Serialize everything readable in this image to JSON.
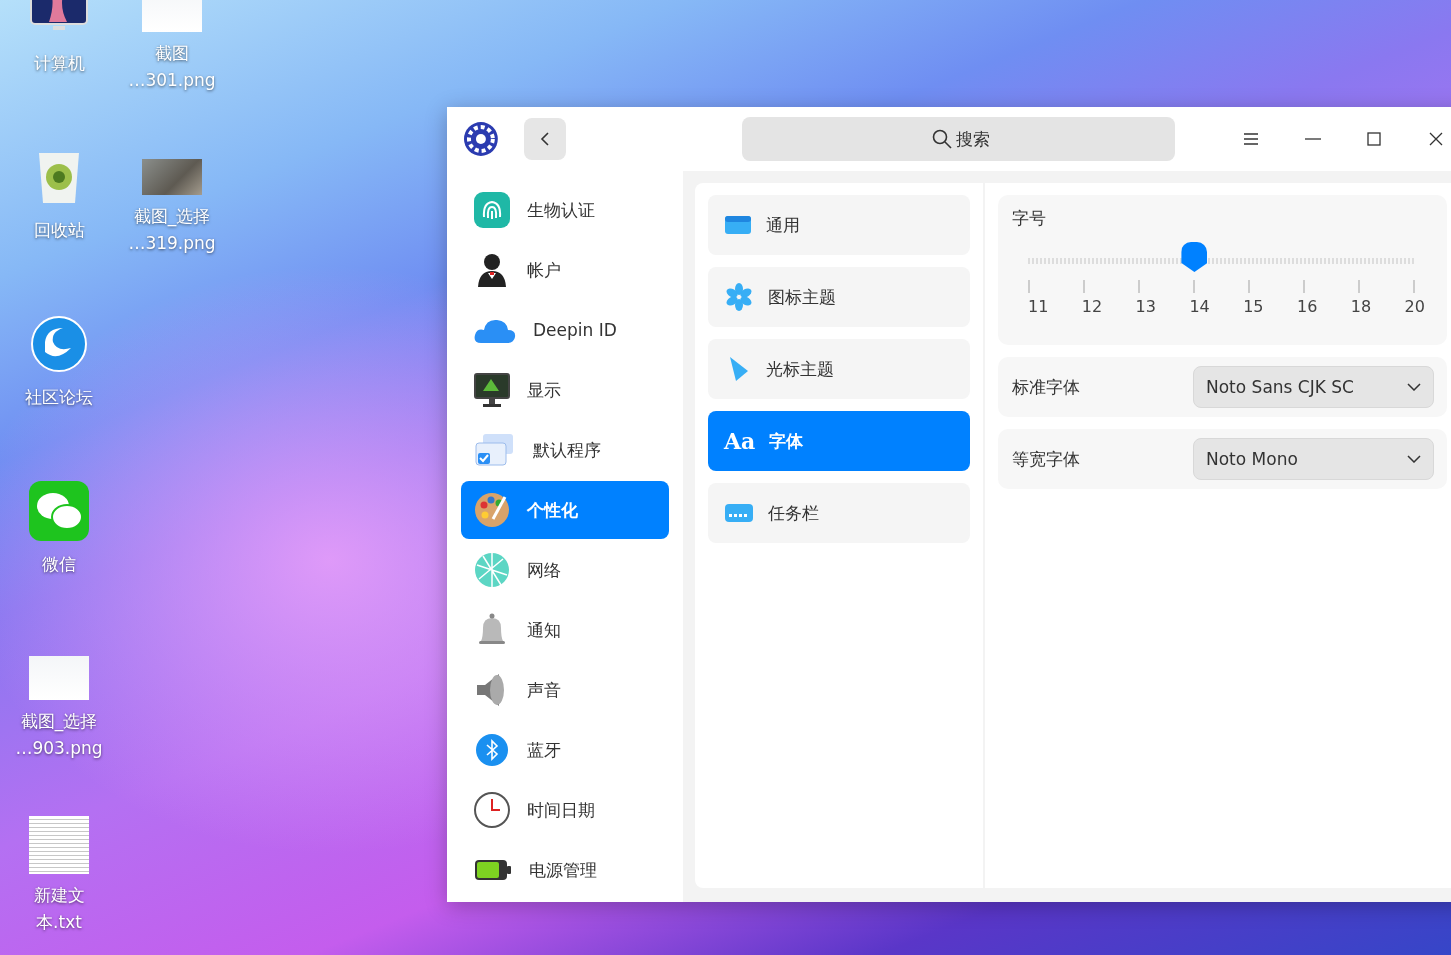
{
  "desktop_icons": [
    {
      "label_lines": [
        "计算机"
      ],
      "kind": "computer"
    },
    {
      "label_lines": [
        "回收站"
      ],
      "kind": "trash"
    },
    {
      "label_lines": [
        "社区论坛"
      ],
      "kind": "forum"
    },
    {
      "label_lines": [
        "微信"
      ],
      "kind": "chat"
    },
    {
      "label_lines": [
        "截图_选择",
        "…903.png"
      ],
      "kind": "image"
    },
    {
      "label_lines": [
        "新建文",
        "本.txt"
      ],
      "kind": "text"
    },
    {
      "label_lines": [
        "截图",
        "…301.png"
      ],
      "kind": "image"
    },
    {
      "label_lines": [
        "截图_选择",
        "…319.png"
      ],
      "kind": "photo"
    }
  ],
  "window": {
    "search": {
      "placeholder": "搜索"
    },
    "sidebar": {
      "items": [
        {
          "label": "生物认证",
          "selected": false
        },
        {
          "label": "帐户",
          "selected": false
        },
        {
          "label": "Deepin ID",
          "selected": false
        },
        {
          "label": "显示",
          "selected": false
        },
        {
          "label": "默认程序",
          "selected": false
        },
        {
          "label": "个性化",
          "selected": true
        },
        {
          "label": "网络",
          "selected": false
        },
        {
          "label": "通知",
          "selected": false
        },
        {
          "label": "声音",
          "selected": false
        },
        {
          "label": "蓝牙",
          "selected": false
        },
        {
          "label": "时间日期",
          "selected": false
        },
        {
          "label": "电源管理",
          "selected": false
        }
      ]
    },
    "subsections": [
      {
        "label": "通用",
        "selected": false
      },
      {
        "label": "图标主题",
        "selected": false
      },
      {
        "label": "光标主题",
        "selected": false
      },
      {
        "label": "字体",
        "selected": true,
        "glyph": "Aa"
      },
      {
        "label": "任务栏",
        "selected": false
      }
    ],
    "font_size": {
      "title": "字号",
      "level": 0.43,
      "ticks": [
        "11",
        "12",
        "13",
        "14",
        "15",
        "16",
        "18",
        "20"
      ]
    },
    "font_rows": [
      {
        "label": "标准字体",
        "value": "Noto Sans CJK SC"
      },
      {
        "label": "等宽字体",
        "value": "Noto Mono"
      }
    ]
  }
}
